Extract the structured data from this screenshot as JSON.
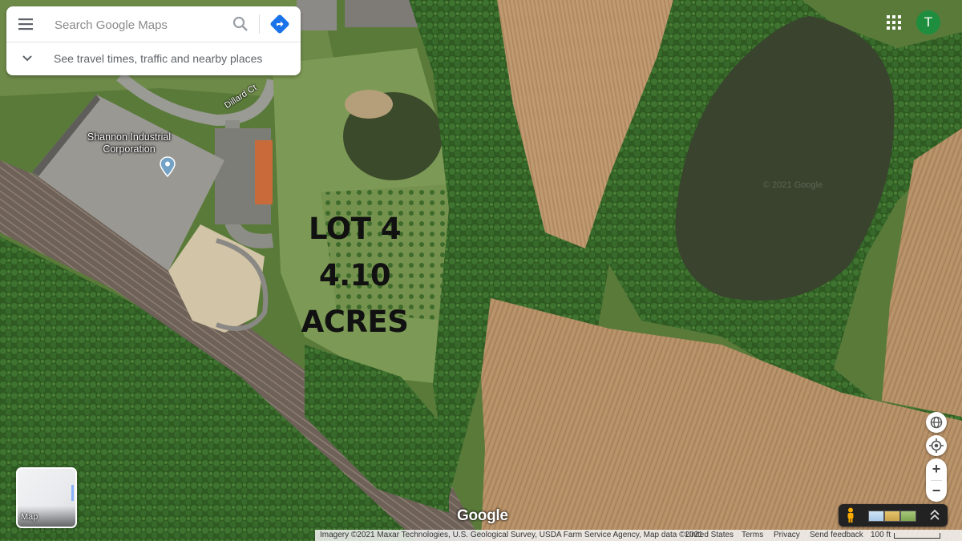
{
  "search": {
    "placeholder": "Search Google Maps",
    "travel_prompt": "See travel times, traffic and nearby places"
  },
  "account": {
    "avatar_letter": "T"
  },
  "map": {
    "poi": {
      "name_line1": "Shannon Industrial",
      "name_line2": "Corporation"
    },
    "road_name": "Dillard Ct",
    "overlay_lines": [
      "LOT 4",
      "4.10",
      "ACRES"
    ],
    "watermark": "© 2021 Google"
  },
  "layers": {
    "label": "Map"
  },
  "logo": "Google",
  "footer": {
    "imagery": "Imagery ©2021 Maxar Technologies, U.S. Geological Survey, USDA Farm Service Agency, Map data ©2021",
    "country": "United States",
    "terms": "Terms",
    "privacy": "Privacy",
    "feedback": "Send feedback",
    "scale": "100 ft"
  },
  "colors": {
    "brand_blue": "#1a73e8",
    "avatar_green": "#1e8e3e",
    "pin_blue": "#74a2c6"
  }
}
